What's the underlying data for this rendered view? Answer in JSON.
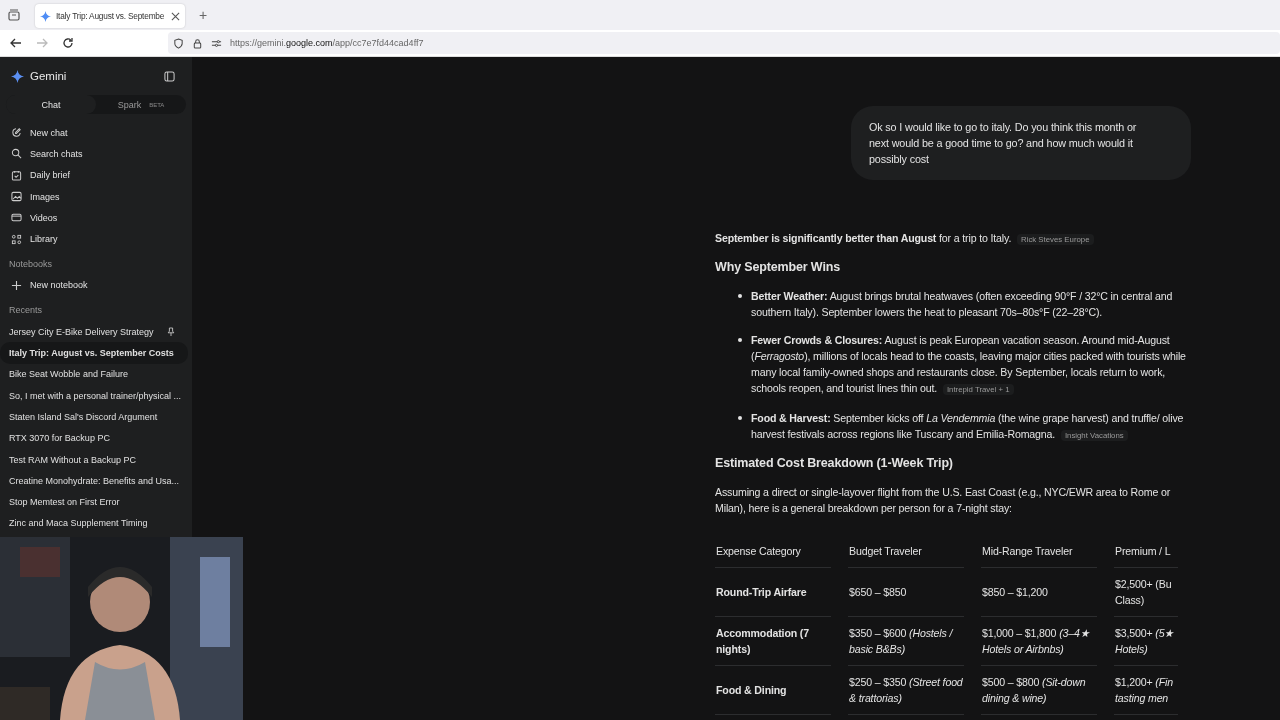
{
  "browser": {
    "tabs": [
      {
        "title": "Italy Trip: August vs. Septembe",
        "selected": true
      }
    ],
    "new_tab": "+",
    "url": {
      "scheme": "https://gemini.",
      "domain": "google.com",
      "path": "/app/cc7e7fd44cad4ff7"
    }
  },
  "sidebar": {
    "app_name": "Gemini",
    "modes": [
      {
        "label": "Chat",
        "selected": true
      },
      {
        "label": "Spark",
        "badge": "BETA",
        "selected": false
      }
    ],
    "nav": [
      "New chat",
      "Search chats",
      "Daily brief",
      "Images",
      "Videos",
      "Library"
    ],
    "notebooks_heading": "Notebooks",
    "new_notebook": "New notebook",
    "recents_heading": "Recents",
    "recents": [
      {
        "title": "Jersey City E-Bike Delivery Strategy",
        "selected": false,
        "pinned": true
      },
      {
        "title": "Italy Trip: August vs. September Costs",
        "selected": true,
        "pinned": false
      },
      {
        "title": "Bike Seat Wobble and Failure",
        "selected": false,
        "pinned": false
      },
      {
        "title": "So, I met with a personal trainer/physical ...",
        "selected": false,
        "pinned": false
      },
      {
        "title": "Staten Island Sal's Discord Argument",
        "selected": false,
        "pinned": false
      },
      {
        "title": "RTX 3070 for Backup PC",
        "selected": false,
        "pinned": false
      },
      {
        "title": "Test RAM Without a Backup PC",
        "selected": false,
        "pinned": false
      },
      {
        "title": "Creatine Monohydrate: Benefits and Usa...",
        "selected": false,
        "pinned": false
      },
      {
        "title": "Stop Memtest on First Error",
        "selected": false,
        "pinned": false
      },
      {
        "title": "Zinc and Maca Supplement Timing",
        "selected": false,
        "pinned": false
      }
    ]
  },
  "chat": {
    "user_message": "Ok so I would like to go to italy. Do you think this month or next would be a good time to go? and how much would it possibly cost",
    "response": {
      "intro": "**September is significantly better than August** for a trip to Italy.",
      "intro_source": "Rick Steves Europe",
      "heading_1": "Why September Wins",
      "bullets": [
        {
          "text": "**Better Weather:** August brings brutal heatwaves (often exceeding 90°F / 32°C in central and southern Italy). September lowers the heat to pleasant 70s–80s°F (22–28°C)."
        },
        {
          "text": "**Fewer Crowds & Closures:** August is peak European vacation season. Around mid-August (*Ferragosto*), millions of locals head to the coasts, leaving major cities packed with tourists while many local family-owned shops and restaurants close. By September, locals return to work, schools reopen, and tourist lines thin out.",
          "source": "Intrepid Travel + 1"
        },
        {
          "text": "**Food & Harvest:** September kicks off *La Vendemmia* (the wine grape harvest) and truffle/ olive harvest festivals across regions like Tuscany and Emilia-Romagna.",
          "source": "Insight Vacations"
        }
      ],
      "heading_2": "Estimated Cost Breakdown (1-Week Trip)",
      "paragraph": "Assuming a direct or single-layover flight from the U.S. East Coast (e.g., NYC/EWR area to Rome or Milan), here is a general breakdown per person for a 7-night stay:",
      "table": {
        "columns": [
          "Expense Category",
          "Budget Traveler",
          "Mid-Range Traveler",
          "Premium / L"
        ],
        "rows": [
          [
            "Round-Trip Airfare",
            "$650 – $850",
            "$850 – $1,200",
            "$2,500+ (Bu Class)"
          ],
          [
            "Accommodation (7 nights)",
            "$350 – $600 *(Hostels / basic B&Bs)*",
            "$1,000 – $1,800 *(3–4★ Hotels or Airbnbs)*",
            "$3,500+ *(5★ Hotels)*"
          ],
          [
            "Food & Dining",
            "$250 – $350 *(Street food & trattorias)*",
            "$500 – $800 *(Sit-down dining & wine)*",
            "$1,200+ *(Fin tasting men*"
          ]
        ]
      }
    }
  }
}
